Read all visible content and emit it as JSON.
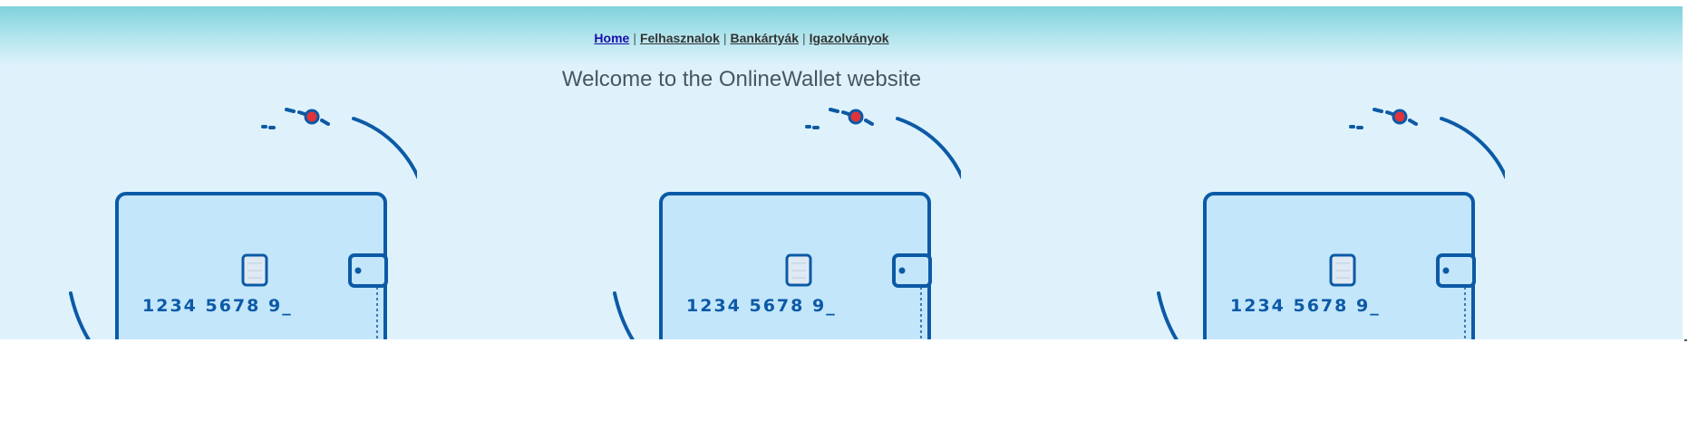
{
  "nav": {
    "links": [
      {
        "label": "Home",
        "active": true
      },
      {
        "label": "Felhasznalok",
        "active": false
      },
      {
        "label": "Bankártyák",
        "active": false
      },
      {
        "label": "Igazolványok",
        "active": false
      }
    ],
    "separator": "|"
  },
  "welcome_text": "Welcome to the OnlineWallet website",
  "cards": [
    {
      "number": "1234 5678 9_",
      "icon": "wallet-card-icon"
    },
    {
      "number": "1234 5678 9_",
      "icon": "wallet-card-icon"
    },
    {
      "number": "1234 5678 9_",
      "icon": "wallet-card-icon"
    }
  ],
  "colors": {
    "header_top": "#7fd2dc",
    "page_background": "#dff2fc",
    "card_fill": "#c3e6fb",
    "card_stroke": "#0c5aa6",
    "dot_red": "#e2333b"
  }
}
